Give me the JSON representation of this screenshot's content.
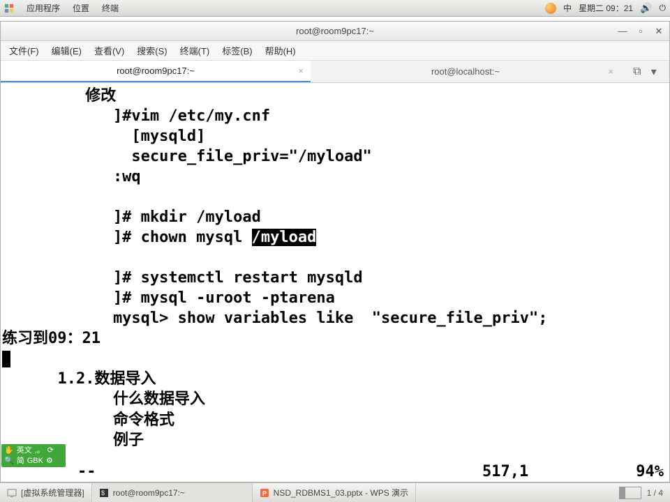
{
  "top_panel": {
    "apps": "应用程序",
    "places": "位置",
    "terminal": "终端",
    "ime": "中",
    "date": "星期二 09：21"
  },
  "window": {
    "title": "root@room9pc17:~"
  },
  "menu": {
    "file": "文件(F)",
    "edit": "编辑(E)",
    "view": "查看(V)",
    "search": "搜索(S)",
    "terminal": "终端(T)",
    "tabs": "标签(B)",
    "help": "帮助(H)"
  },
  "tabs": {
    "t1": "root@room9pc17:~",
    "t2": "root@localhost:~"
  },
  "content": {
    "l1": "         修改",
    "l2": "            ]#vim /etc/my.cnf",
    "l3": "              [mysqld]",
    "l4": "              secure_file_priv=\"/myload\"",
    "l5": "            :wq",
    "l6": "",
    "l7": "            ]# mkdir /myload",
    "l8a": "            ]# chown mysql ",
    "l8b": "/myload",
    "l9": "",
    "l10": "            ]# systemctl restart mysqld",
    "l11": "            ]# mysql -uroot -ptarena",
    "l12": "            mysql> show variables like  \"secure_file_priv\";",
    "l13": "练习到09：21",
    "l14": "",
    "l15": "      1.2.数据导入",
    "l16": "            什么数据导入",
    "l17": "            命令格式",
    "l18": "            例子"
  },
  "status": {
    "dashes": "--",
    "pos": "517,1",
    "pct": "94%"
  },
  "ime_box": {
    "lang": "英文",
    "sym": ",。",
    "r2a": "简",
    "r2b": "GBK"
  },
  "taskbar": {
    "t1": "[虚拟系统管理器]",
    "t2": "root@room9pc17:~",
    "t3": "NSD_RDBMS1_03.pptx - WPS 演示",
    "pager": "1 / 4"
  }
}
